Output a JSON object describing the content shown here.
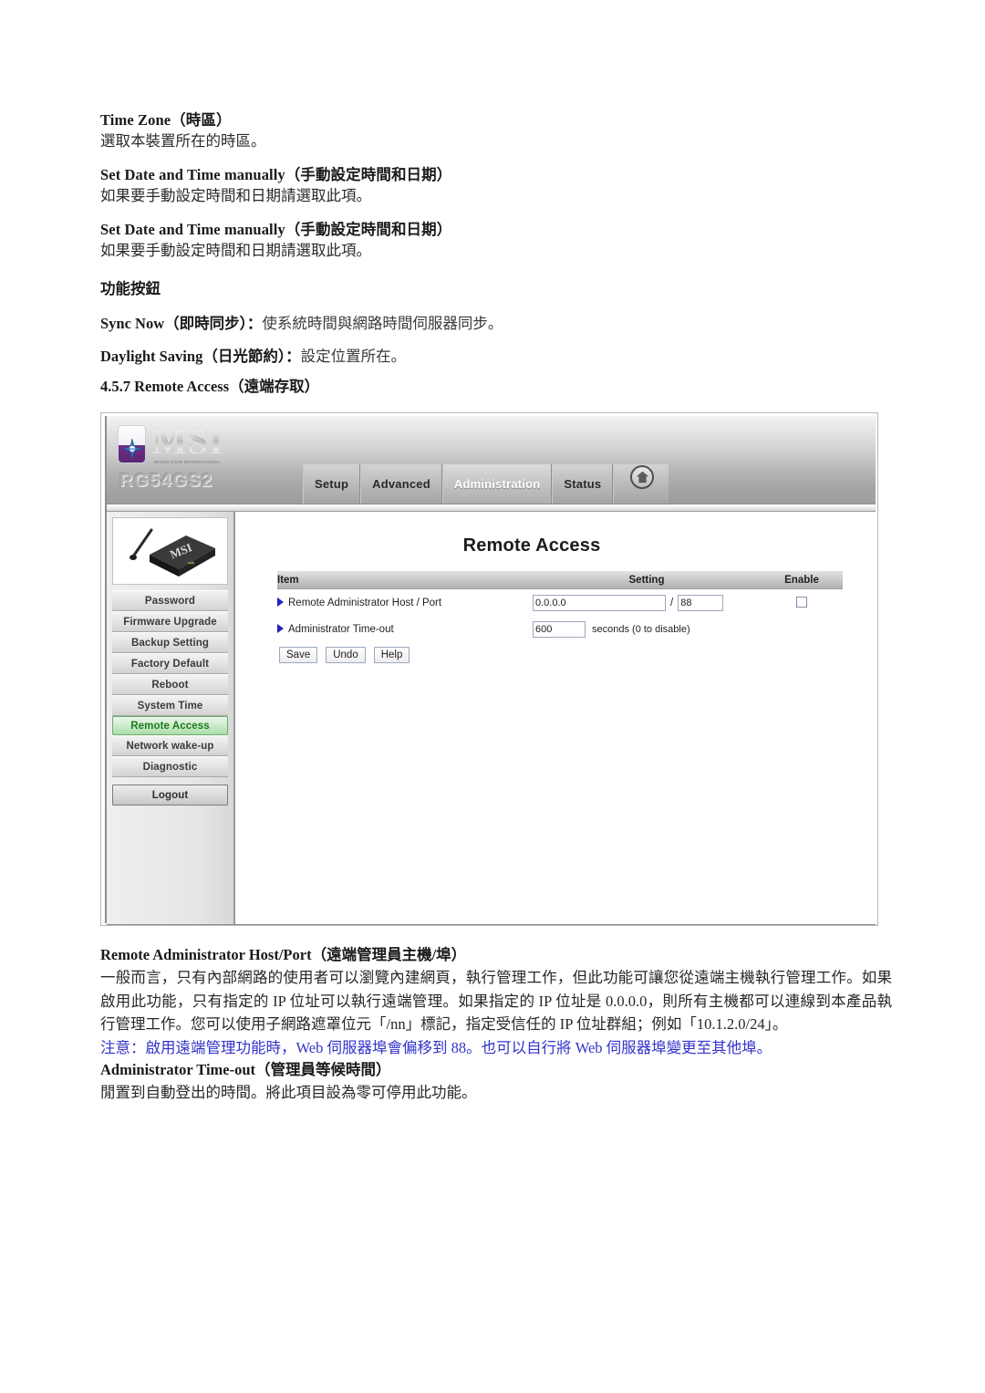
{
  "document": {
    "top_blocks": [
      {
        "heading": "Time Zone（時區）",
        "body": "選取本裝置所在的時區。"
      },
      {
        "heading": "Set Date and Time manually（手動設定時間和日期）",
        "body": "如果要手動設定時間和日期請選取此項。"
      },
      {
        "heading": "Set Date and Time manually（手動設定時間和日期）",
        "body": "如果要手動設定時間和日期請選取此項。"
      }
    ],
    "function_buttons_heading": "功能按鈕",
    "sync_now_line_bold": "Sync Now（即時同步）：",
    "sync_now_line_rest": "使系統時間與網路時間伺服器同步。",
    "daylight_line_bold": "Daylight Saving（日光節約）：",
    "daylight_line_rest": "設定位置所在。",
    "section_heading": "4.5.7 Remote Access（遠端存取）",
    "bottom": {
      "heading1": "Remote Administrator Host/Port（遠端管理員主機/埠）",
      "body1": "一般而言，只有內部網路的使用者可以瀏覽內建網頁，執行管理工作，但此功能可讓您從遠端主機執行管理工作。如果啟用此功能，只有指定的 IP 位址可以執行遠端管理。如果指定的 IP 位址是 0.0.0.0，則所有主機都可以連線到本產品執行管理工作。您可以使用子網路遮罩位元「/nn」標記，指定受信任的 IP 位址群組；例如「10.1.2.0/24」。",
      "note": "注意：啟用遠端管理功能時，Web 伺服器埠會偏移到 88。也可以自行將 Web 伺服器埠變更至其他埠。",
      "heading2": "Administrator Time-out（管理員等候時間）",
      "body2": "閒置到自動登出的時間。將此項目設為零可停用此功能。"
    }
  },
  "router_ui": {
    "brand": "MSI",
    "brand_tagline": "MICRO-STAR INTERNATIONAL",
    "model": "RG54GS2",
    "nav_tabs": [
      {
        "label": "Setup",
        "active": false
      },
      {
        "label": "Advanced",
        "active": false
      },
      {
        "label": "Administration",
        "active": true
      },
      {
        "label": "Status",
        "active": false
      }
    ],
    "home_icon": "home-icon",
    "device_label": "MSI",
    "sidebar": {
      "items": [
        {
          "label": "Password",
          "active": false
        },
        {
          "label": "Firmware Upgrade",
          "active": false
        },
        {
          "label": "Backup Setting",
          "active": false
        },
        {
          "label": "Factory Default",
          "active": false
        },
        {
          "label": "Reboot",
          "active": false
        },
        {
          "label": "System Time",
          "active": false
        },
        {
          "label": "Remote Access",
          "active": true
        },
        {
          "label": "Network wake-up",
          "active": false
        },
        {
          "label": "Diagnostic",
          "active": false
        }
      ],
      "logout_label": "Logout"
    },
    "page_title": "Remote Access",
    "table": {
      "headers": [
        "Item",
        "Setting",
        "Enable"
      ],
      "rows": [
        {
          "item": "Remote Administrator Host / Port",
          "host_value": "0.0.0.0",
          "separator": "/",
          "port_value": "88",
          "enable_checked": false
        },
        {
          "item": "Administrator Time-out",
          "timeout_value": "600",
          "timeout_hint": "seconds (0 to disable)"
        }
      ]
    },
    "buttons": [
      {
        "label": "Save"
      },
      {
        "label": "Undo"
      },
      {
        "label": "Help"
      }
    ]
  },
  "colors": {
    "note_blue": "#3333cc",
    "active_sidebar_green": "#1e7a1e",
    "bullet_blue": "#2020c0"
  }
}
